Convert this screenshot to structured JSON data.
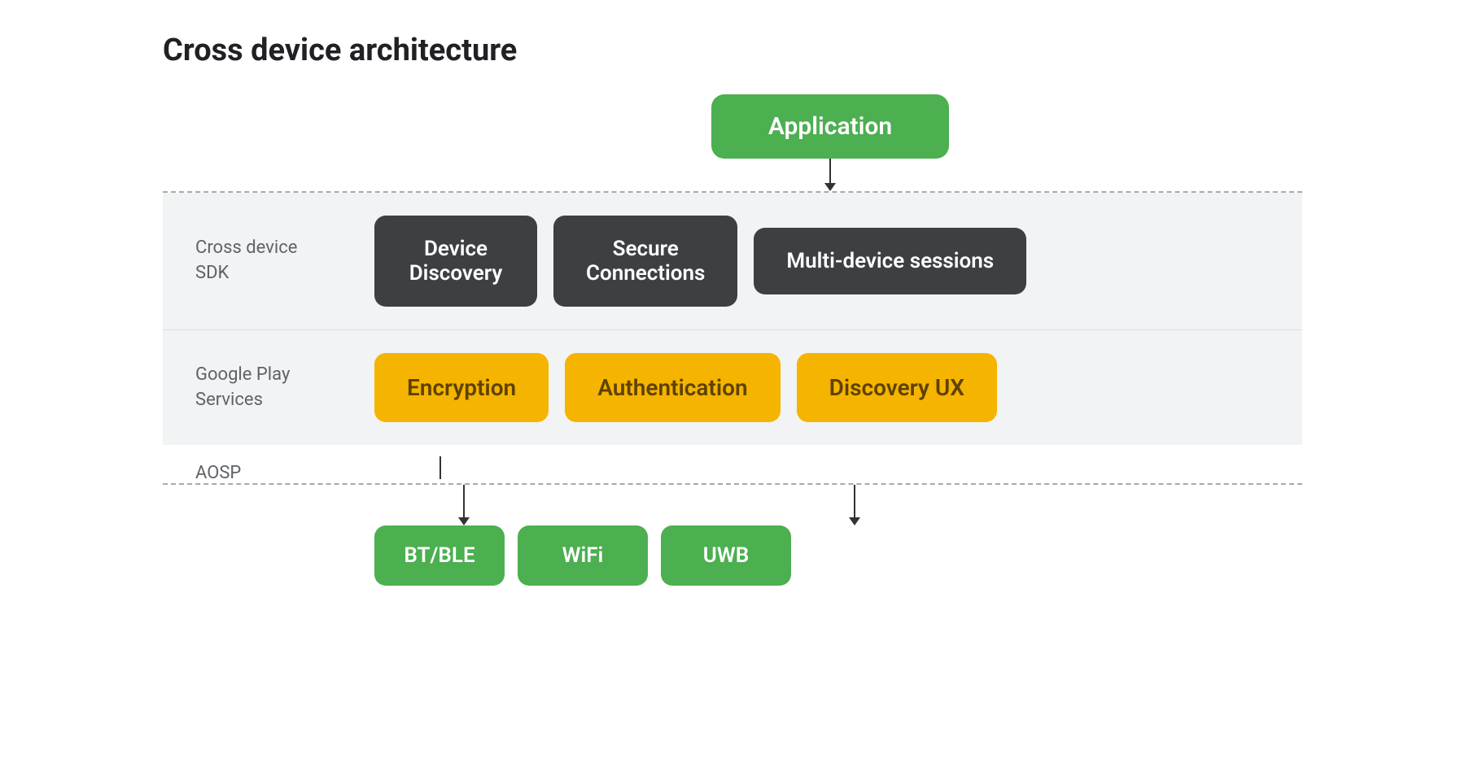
{
  "title": "Cross device architecture",
  "application": {
    "label": "Application"
  },
  "sdk_band": {
    "label": "Cross device\nSDK",
    "boxes": [
      {
        "id": "device-discovery",
        "label": "Device\nDiscovery"
      },
      {
        "id": "secure-connections",
        "label": "Secure\nConnections"
      },
      {
        "id": "multi-device-sessions",
        "label": "Multi-device sessions"
      }
    ]
  },
  "play_band": {
    "label": "Google Play\nServices",
    "boxes": [
      {
        "id": "encryption",
        "label": "Encryption"
      },
      {
        "id": "authentication",
        "label": "Authentication"
      },
      {
        "id": "discovery-ux",
        "label": "Discovery UX"
      }
    ]
  },
  "aosp": {
    "label": "AOSP"
  },
  "bottom_boxes": [
    {
      "id": "bt-ble",
      "label": "BT/BLE"
    },
    {
      "id": "wifi",
      "label": "WiFi"
    },
    {
      "id": "uwb",
      "label": "UWB"
    }
  ]
}
